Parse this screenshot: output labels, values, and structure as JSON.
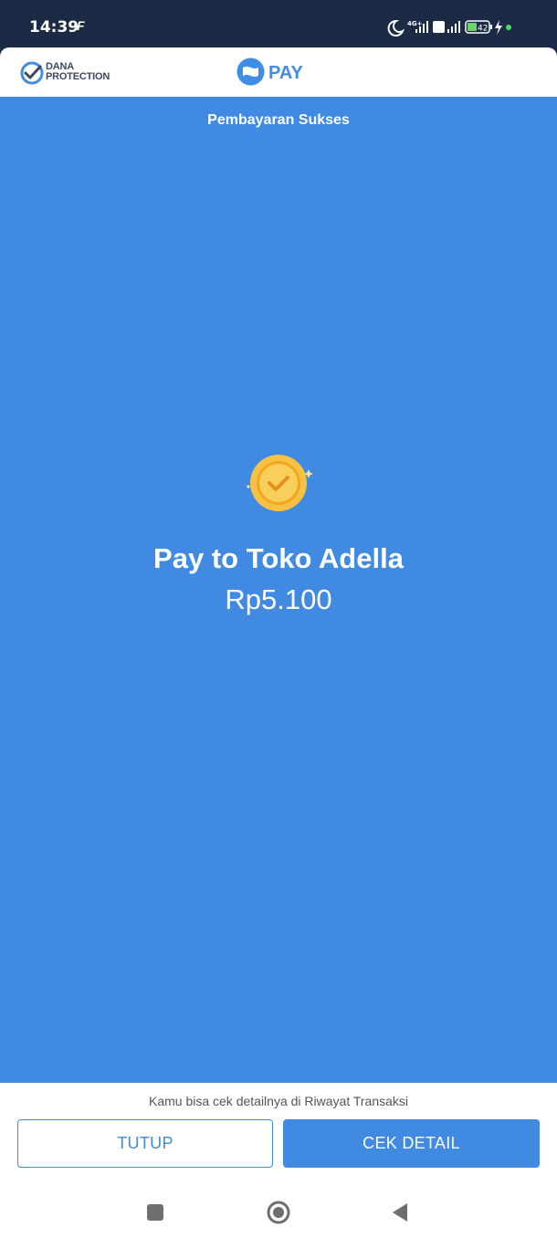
{
  "status_bar": {
    "time": "14:39",
    "carrier_glyph": "F",
    "network_1": "4G+",
    "network_2": "Vo LTE",
    "battery": "42"
  },
  "header": {
    "protection_logo": {
      "icon": "shield-check-icon",
      "line1": "DANA",
      "line2": "PROTECTION"
    },
    "pay_logo": {
      "icon": "dana-wallet-icon",
      "label": "PAY"
    }
  },
  "main": {
    "title": "Pembayaran Sukses",
    "status_icon": "gold-coin-check-icon",
    "merchant_line": "Pay to Toko Adella",
    "amount": "Rp5.100"
  },
  "footer": {
    "hint": "Kamu bisa cek detailnya di Riwayat Transaksi",
    "close_label": "TUTUP",
    "detail_label": "CEK DETAIL"
  },
  "nav": {
    "recents_icon": "square-icon",
    "home_icon": "circle-icon",
    "back_icon": "triangle-back-icon"
  },
  "colors": {
    "primary": "#418ae2",
    "status_bar": "#1b2b45",
    "coin": "#f6c243"
  }
}
